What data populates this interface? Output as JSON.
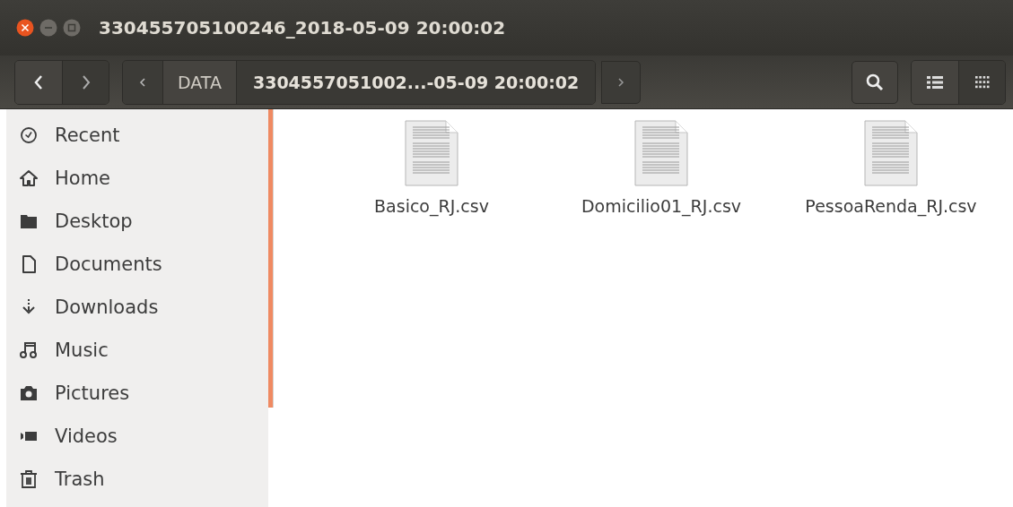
{
  "window": {
    "title": "330455705100246_2018-05-09 20:00:02"
  },
  "path_bar": {
    "segments": [
      {
        "label": "DATA",
        "selected": false
      },
      {
        "label": "3304557051002...-05-09 20:00:02",
        "selected": true
      }
    ]
  },
  "view_buttons": [
    {
      "kind": "list",
      "selected": false
    },
    {
      "kind": "grid",
      "selected": true
    }
  ],
  "sidebar": {
    "items": [
      {
        "kind": "recent",
        "label": "Recent"
      },
      {
        "kind": "home",
        "label": "Home"
      },
      {
        "kind": "folder",
        "label": "Desktop"
      },
      {
        "kind": "document",
        "label": "Documents"
      },
      {
        "kind": "download",
        "label": "Downloads"
      },
      {
        "kind": "music",
        "label": "Music"
      },
      {
        "kind": "camera",
        "label": "Pictures"
      },
      {
        "kind": "video",
        "label": "Videos"
      },
      {
        "kind": "trash",
        "label": "Trash"
      }
    ]
  },
  "files": [
    {
      "name": "Basico_RJ.csv"
    },
    {
      "name": "Domicilio01_RJ.csv"
    },
    {
      "name": "PessoaRenda_RJ.csv"
    }
  ]
}
